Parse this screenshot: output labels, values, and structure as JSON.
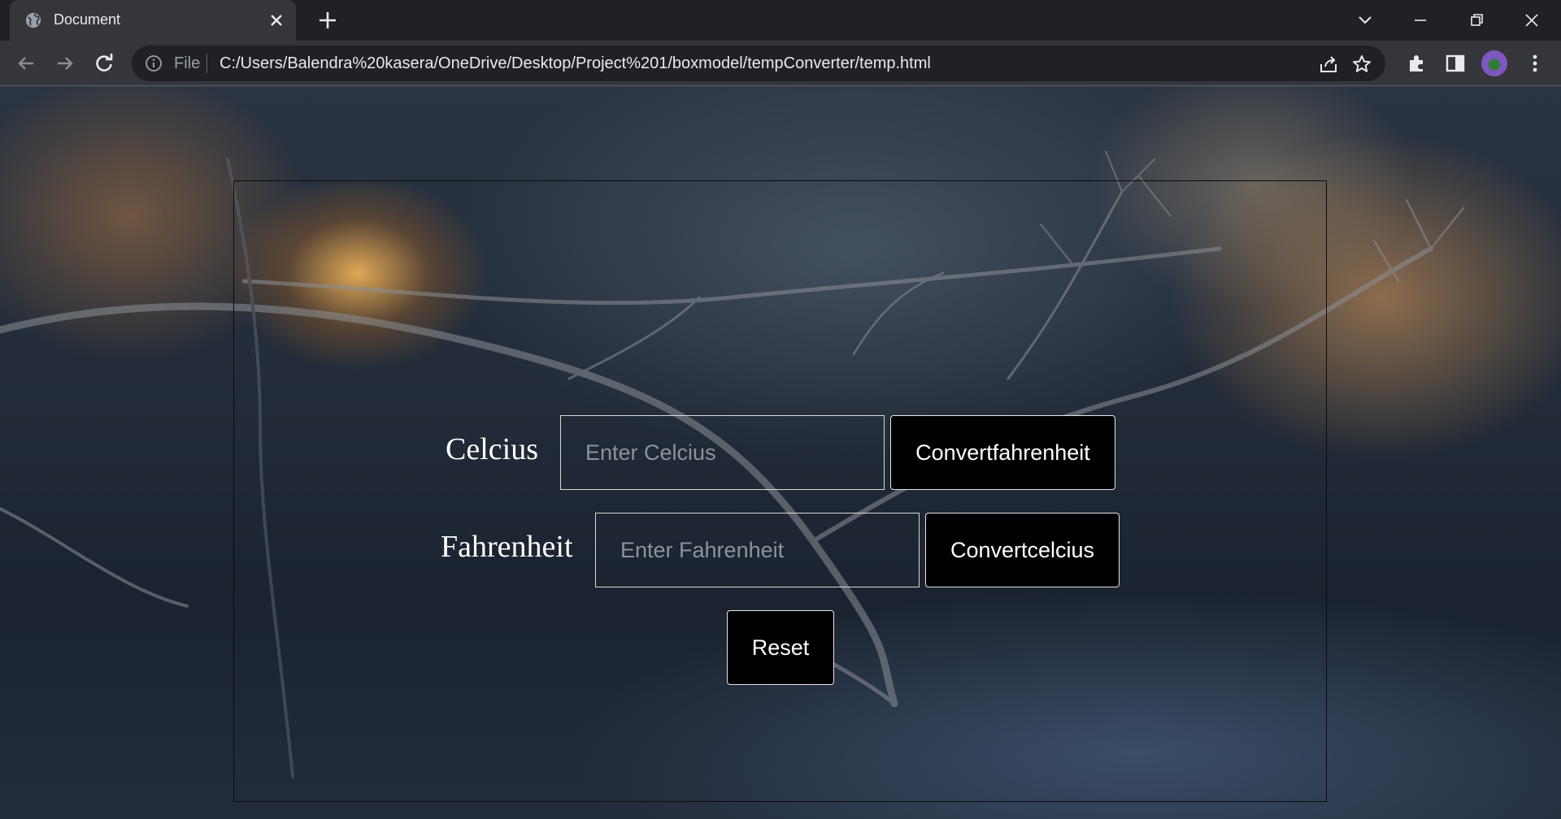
{
  "browser": {
    "tab_title": "Document",
    "scheme_label": "File",
    "url": "C:/Users/Balendra%20kasera/OneDrive/Desktop/Project%201/boxmodel/tempConverter/temp.html",
    "icons": [
      "globe-icon",
      "close-icon",
      "plus-icon",
      "chevron-down-icon",
      "minimize-icon",
      "restore-icon",
      "window-close-icon",
      "back-arrow-icon",
      "forward-arrow-icon",
      "reload-icon",
      "info-icon",
      "share-icon",
      "star-icon",
      "extensions-icon",
      "side-panel-icon",
      "profile-avatar",
      "kebab-menu-icon"
    ]
  },
  "converter": {
    "celsius_label": "Celcius",
    "celsius_placeholder": "Enter Celcius",
    "celsius_value": "",
    "convert_fahrenheit_button": "Convertfahrenheit",
    "fahrenheit_label": "Fahrenheit",
    "fahrenheit_placeholder": "Enter Fahrenheit",
    "fahrenheit_value": "",
    "convert_celsius_button": "Convertcelcius",
    "reset_button": "Reset"
  },
  "colors": {
    "chrome_dark": "#202124",
    "chrome_toolbar": "#35363a",
    "button_bg": "#000000",
    "label_text": "#ffffff",
    "placeholder_text": "#8d939b"
  }
}
